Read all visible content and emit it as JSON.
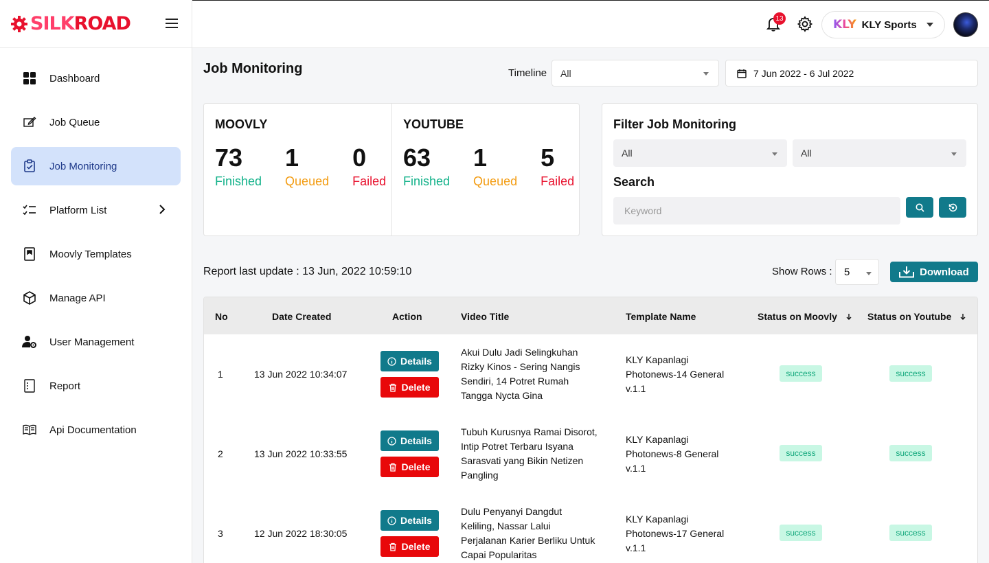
{
  "brand": {
    "part1": "SILK",
    "part2": "ROAD"
  },
  "sidebar": {
    "items": [
      {
        "label": "Dashboard",
        "icon": "dashboard-icon"
      },
      {
        "label": "Job Queue",
        "icon": "edit-icon"
      },
      {
        "label": "Job Monitoring",
        "icon": "clipboard-check-icon",
        "active": true
      },
      {
        "label": "Platform List",
        "icon": "checklist-icon",
        "has_children": true
      },
      {
        "label": "Moovly Templates",
        "icon": "template-icon"
      },
      {
        "label": "Manage API",
        "icon": "cube-icon"
      },
      {
        "label": "User Management",
        "icon": "user-gear-icon"
      },
      {
        "label": "Report",
        "icon": "report-icon"
      },
      {
        "label": "Api Documentation",
        "icon": "book-icon"
      }
    ]
  },
  "header": {
    "notification_count": "13",
    "account_logo": "KLY",
    "account_name": "KLY Sports"
  },
  "page": {
    "title": "Job Monitoring",
    "timeline_label": "Timeline",
    "timeline_value": "All",
    "date_range": "7 Jun 2022 - 6 Jul 2022"
  },
  "stats": [
    {
      "platform": "MOOVLY",
      "finished": "73",
      "queued": "1",
      "failed": "0"
    },
    {
      "platform": "YOUTUBE",
      "finished": "63",
      "queued": "1",
      "failed": "5"
    }
  ],
  "stat_labels": {
    "finished": "Finished",
    "queued": "Queued",
    "failed": "Failed"
  },
  "filter": {
    "title": "Filter Job Monitoring",
    "select1": "All",
    "select2": "All",
    "search_label": "Search",
    "keyword_placeholder": "Keyword"
  },
  "report": {
    "last_update": "Report last update : 13 Jun, 2022 10:59:10",
    "show_rows_label": "Show Rows :",
    "show_rows_value": "5",
    "download_label": "Download"
  },
  "table": {
    "headers": [
      "No",
      "Date Created",
      "Action",
      "Video Title",
      "Template Name",
      "Status on Moovly",
      "Status on Youtube"
    ],
    "details_label": "Details",
    "delete_label": "Delete",
    "rows": [
      {
        "no": "1",
        "date": "13 Jun 2022 10:34:07",
        "title_lines": [
          "Akui Dulu Jadi Selingkuhan",
          "Rizky Kinos - Sering Nangis",
          "Sendiri, 14 Potret Rumah",
          "Tangga Nycta Gina"
        ],
        "template_lines": [
          "KLY Kapanlagi",
          "Photonews-14 General",
          "v.1.1"
        ],
        "status_moovly": "success",
        "status_youtube": "success"
      },
      {
        "no": "2",
        "date": "13 Jun 2022 10:33:55",
        "title_lines": [
          "Tubuh Kurusnya Ramai Disorot,",
          "Intip Potret Terbaru Isyana",
          "Sarasvati yang Bikin Netizen",
          "Pangling"
        ],
        "template_lines": [
          "KLY Kapanlagi",
          "Photonews-8 General",
          "v.1.1"
        ],
        "status_moovly": "success",
        "status_youtube": "success"
      },
      {
        "no": "3",
        "date": "12 Jun 2022 18:30:05",
        "title_lines": [
          "Dulu Penyanyi Dangdut",
          "Keliling, Nassar Lalui",
          "Perjalanan Karier Berliku Untuk",
          "Capai Popularitas"
        ],
        "template_lines": [
          "KLY Kapanlagi",
          "Photonews-17 General",
          "v.1.1"
        ],
        "status_moovly": "success",
        "status_youtube": "success"
      }
    ]
  },
  "colors": {
    "brand_red": "#e8112d",
    "teal": "#117a8b",
    "success_green": "#13b28a",
    "queued_orange": "#f39c12",
    "active_nav_bg": "#d3e2fb"
  }
}
